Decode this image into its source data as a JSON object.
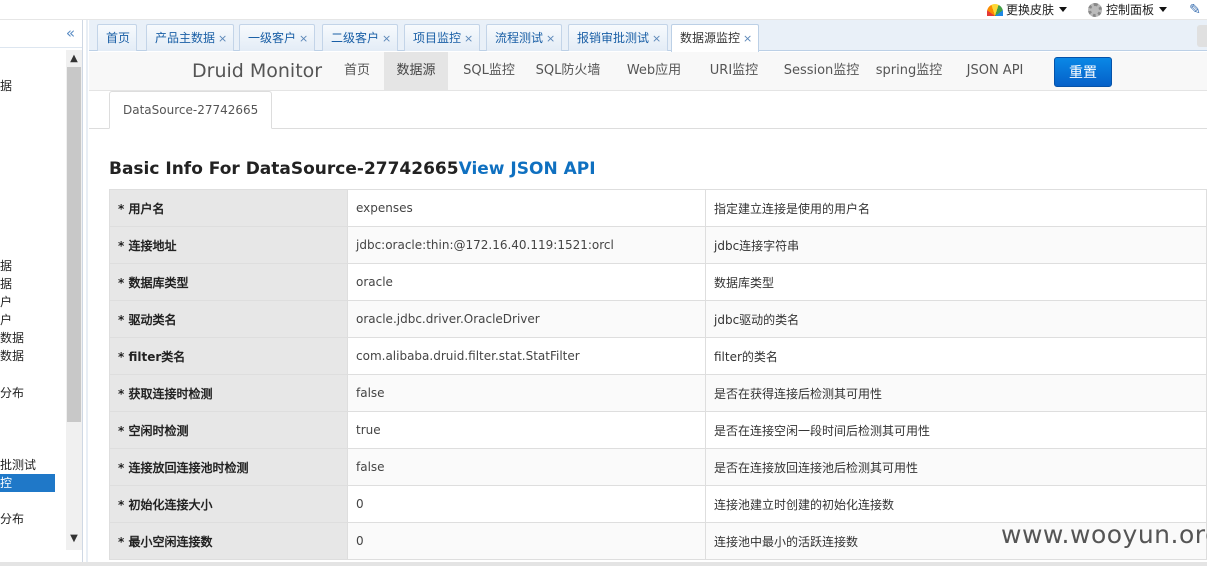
{
  "topbar": {
    "skin_label": "更换皮肤",
    "panel_label": "控制面板"
  },
  "sidebar": {
    "collapse_glyph": "«",
    "items": [
      "据",
      "据",
      "据",
      "户",
      "户",
      "数据",
      "数据",
      "分布",
      "批测试",
      "控",
      "分布"
    ],
    "active_item": "控"
  },
  "tabs": [
    {
      "label": "首页",
      "closable": false
    },
    {
      "label": "产品主数据",
      "closable": true
    },
    {
      "label": "一级客户",
      "closable": true
    },
    {
      "label": "二级客户",
      "closable": true
    },
    {
      "label": "项目监控",
      "closable": true
    },
    {
      "label": "流程测试",
      "closable": true
    },
    {
      "label": "报销审批测试",
      "closable": true
    },
    {
      "label": "数据源监控",
      "closable": true,
      "active": true
    }
  ],
  "druid": {
    "brand": "Druid Monitor",
    "nav": [
      "首页",
      "数据源",
      "SQL监控",
      "SQL防火墙",
      "Web应用",
      "URI监控",
      "Session监控",
      "spring监控",
      "JSON API"
    ],
    "active_nav": "数据源",
    "reset_label": "重置"
  },
  "datasource": {
    "tab_label": "DataSource-27742665",
    "title_prefix": "Basic Info For DataSource-27742665",
    "title_link": "View JSON API"
  },
  "rows": [
    {
      "key": "* 用户名",
      "value": "expenses",
      "desc": "指定建立连接是使用的用户名"
    },
    {
      "key": "* 连接地址",
      "value": "jdbc:oracle:thin:@172.16.40.119:1521:orcl",
      "desc": "jdbc连接字符串"
    },
    {
      "key": "* 数据库类型",
      "value": "oracle",
      "desc": "数据库类型"
    },
    {
      "key": "* 驱动类名",
      "value": "oracle.jdbc.driver.OracleDriver",
      "desc": "jdbc驱动的类名"
    },
    {
      "key": "* filter类名",
      "value": "com.alibaba.druid.filter.stat.StatFilter",
      "desc": "filter的类名"
    },
    {
      "key": "* 获取连接时检测",
      "value": "false",
      "desc": "是否在获得连接后检测其可用性"
    },
    {
      "key": "* 空闲时检测",
      "value": "true",
      "desc": "是否在连接空闲一段时间后检测其可用性"
    },
    {
      "key": "* 连接放回连接池时检测",
      "value": "false",
      "desc": "是否在连接放回连接池后检测其可用性"
    },
    {
      "key": "* 初始化连接大小",
      "value": "0",
      "desc": "连接池建立时创建的初始化连接数"
    },
    {
      "key": "* 最小空闲连接数",
      "value": "0",
      "desc": "连接池中最小的活跃连接数"
    }
  ],
  "watermark": "www.wooyun.org"
}
